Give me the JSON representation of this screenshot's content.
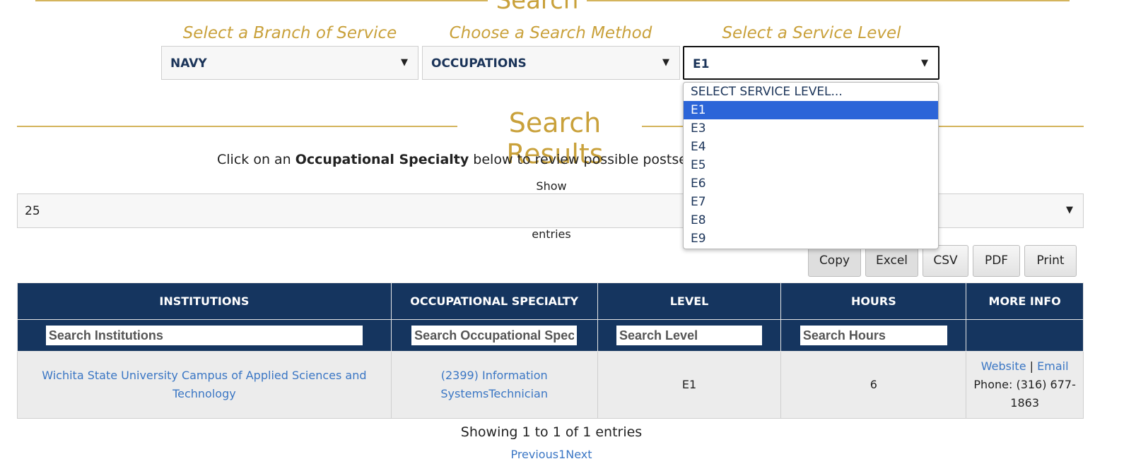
{
  "search": {
    "title": "Search",
    "labels": [
      "Select a Branch of Service",
      "Choose a Search Method",
      "Select a Service Level"
    ],
    "branch_value": "NAVY",
    "method_value": "OCCUPATIONS",
    "level_value": "E1",
    "level_options": [
      "SELECT SERVICE LEVEL...",
      "E1",
      "E3",
      "E4",
      "E5",
      "E6",
      "E7",
      "E8",
      "E9"
    ],
    "level_selected": "E1"
  },
  "results": {
    "title": "Search Results",
    "intro_before": "Click on an ",
    "intro_bold": "Occupational Specialty",
    "intro_after": " below to review possible postsecondary cr",
    "show_label": "Show",
    "length_value": "25",
    "entries_label": "entries",
    "buttons": [
      "Copy",
      "Excel",
      "CSV",
      "PDF",
      "Print"
    ]
  },
  "table": {
    "headers": [
      "INSTITUTIONS",
      "OCCUPATIONAL SPECIALTY",
      "LEVEL",
      "HOURS",
      "MORE INFO"
    ],
    "filters": [
      "Search Institutions",
      "Search Occupational Spec",
      "Search Level",
      "Search Hours"
    ],
    "rows": [
      {
        "institution": "Wichita State University Campus of Applied Sciences and Technology",
        "specialty_line1": "(2399) Information",
        "specialty_line2": "SystemsTechnician",
        "level": "E1",
        "hours": "6",
        "website": "Website",
        "separator": "|",
        "email": "Email",
        "phone_line1": "Phone: (316) 677-",
        "phone_line2": "1863"
      }
    ]
  },
  "footer": {
    "showing": "Showing 1 to 1 of 1 entries",
    "prev": "Previous",
    "page": "1",
    "next": "Next"
  },
  "colors": {
    "accent_gold": "#c9a13b",
    "header_navy": "#15355f",
    "link_blue": "#3a76c4",
    "option_highlight": "#2c65d8"
  }
}
